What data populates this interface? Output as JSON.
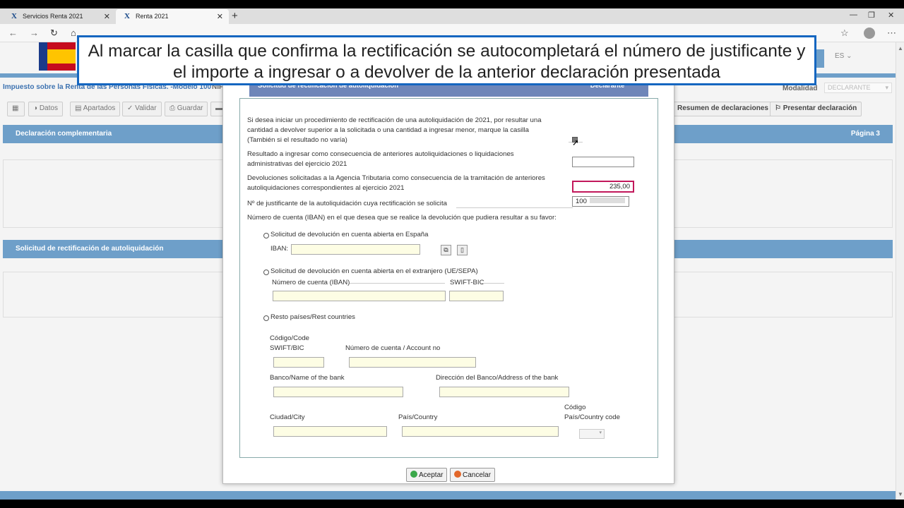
{
  "browser": {
    "tabs": [
      {
        "label": "Servicios Renta 2021",
        "icon": "aeat-favicon",
        "close": "✕"
      },
      {
        "label": "Renta 2021",
        "icon": "aeat-favicon",
        "close": "✕"
      }
    ],
    "new_tab": "+"
  },
  "caption": {
    "text": "Al marcar la casilla que confirma la rectificación se autocompletará el número de justificante y el importe a ingresar o a devolver de la anterior declaración presentada"
  },
  "header": {
    "title": "Impuesto sobre la Renta de las Personas Físicas. -Modelo 100",
    "nif_label": "NIF",
    "language": "ES",
    "modalidad_label": "Modalidad",
    "modalidad_value": "DECLARANTE"
  },
  "toolbar": {
    "datos": "Datos",
    "apartados": "Apartados",
    "validar": "Validar",
    "guardar": "Guardar",
    "resumen": "Resumen de declaraciones",
    "presentar": "Presentar declaración"
  },
  "sections": {
    "complementaria": "Declaración complementaria",
    "pagina": "Página 3",
    "rectificacion": "Solicitud de rectificación de autoliquidación"
  },
  "dialog": {
    "title": "Solicitud de rectificación de autoliquidación",
    "col_header": "Modalidad Declarante",
    "q1": "Si desea iniciar un procedimiento de rectificación de una autoliquidación de 2021, por resultar una cantidad a devolver superior a la solicitada o una cantidad a ingresar menor, marque la casilla (También si el resultado no varía)",
    "q2": "Resultado a ingresar como consecuencia de anteriores autoliquidaciones o liquidaciones administrativas del ejercicio 2021",
    "q2_value": "",
    "q3": "Devoluciones solicitadas a la Agencia Tributaria como consecuencia de la tramitación de anteriores autoliquidaciones correspondientes al ejercicio 2021",
    "q3_value": "235,00",
    "q4": "Nº de justificante de la autoliquidación cuya rectificación se solicita",
    "q4_value": "100",
    "q5": "Número de cuenta (IBAN) en el que desea que se realice la devolución que pudiera resultar a su favor:",
    "opt_spain": "Solicitud de devolución en cuenta abierta en España",
    "iban_label": "IBAN:",
    "opt_foreign": "Solicitud de devolución en cuenta abierta en el extranjero (UE/SEPA)",
    "num_cuenta_iban": "Número de cuenta (IBAN)",
    "swift_bic": "SWIFT-BIC",
    "opt_rest": "Resto países/Rest countries",
    "codigo_code": "Código/Code",
    "swift_bic2": "SWIFT/BIC",
    "num_cuenta_account": "Número de cuenta / Account no",
    "banco_name": "Banco/Name of the bank",
    "direccion_banco": "Dirección del Banco/Address of the bank",
    "ciudad_city": "Ciudad/City",
    "pais_country": "País/Country",
    "codigo_pais": "Código",
    "pais_country_code": "País/Country code",
    "aceptar": "Aceptar",
    "cancelar": "Cancelar"
  },
  "colors": {
    "accent_blue": "#6e9fc9",
    "dialog_header": "#6e86b9",
    "caption_border": "#1566c0",
    "highlight_red": "#c2185b",
    "field_yellow": "#fdfde4"
  }
}
